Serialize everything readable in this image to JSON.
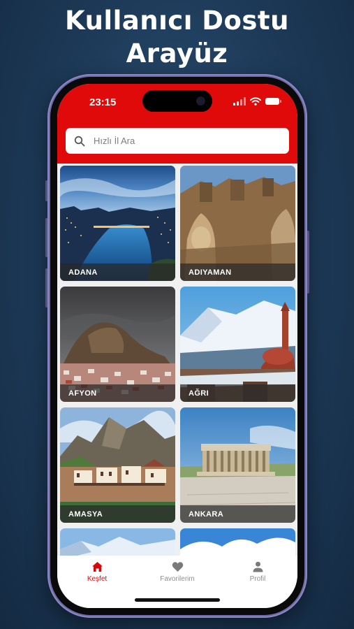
{
  "headline": {
    "line1": "Kullanıcı Dostu",
    "line2": "Arayüz"
  },
  "status_bar": {
    "time": "23:15"
  },
  "search": {
    "placeholder": "Hızlı İl Ara",
    "value": ""
  },
  "cities": [
    {
      "name": "ADANA"
    },
    {
      "name": "ADIYAMAN"
    },
    {
      "name": "AFYON"
    },
    {
      "name": "AĞRI"
    },
    {
      "name": "AMASYA"
    },
    {
      "name": "ANKARA"
    }
  ],
  "tabs": [
    {
      "label": "Keşfet",
      "icon": "home-icon",
      "active": true
    },
    {
      "label": "Favorilerim",
      "icon": "heart-icon",
      "active": false
    },
    {
      "label": "Profil",
      "icon": "person-icon",
      "active": false
    }
  ],
  "colors": {
    "accent_red": "#e10a0a",
    "active_tab": "#d40a0a",
    "inactive_tab": "#8e8e8e",
    "background": "#1d3957",
    "phone_frame": "#6d6aa6"
  }
}
